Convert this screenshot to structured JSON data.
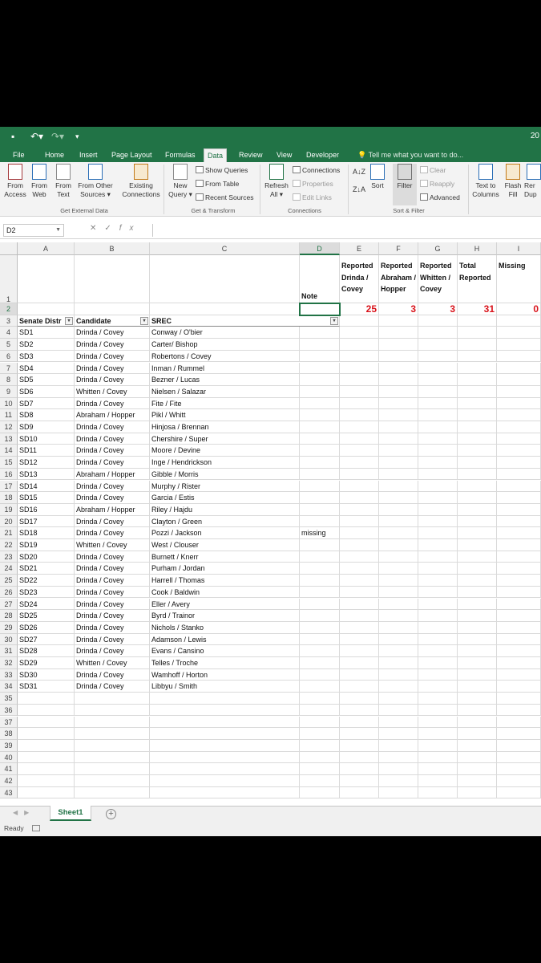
{
  "app": {
    "title_fragment": "20",
    "quick_access": [
      "save-icon",
      "undo-icon",
      "redo-icon",
      "customize-icon"
    ]
  },
  "tabs": [
    "File",
    "Home",
    "Insert",
    "Page Layout",
    "Formulas",
    "Data",
    "Review",
    "View",
    "Developer"
  ],
  "active_tab": "Data",
  "tell_me": "Tell me what you want to do...",
  "ribbon": {
    "get_external": {
      "label": "Get External Data",
      "buttons": [
        {
          "line1": "From",
          "line2": "Access"
        },
        {
          "line1": "From",
          "line2": "Web"
        },
        {
          "line1": "From",
          "line2": "Text"
        },
        {
          "line1": "From Other",
          "line2": "Sources ▾"
        },
        {
          "line1": "Existing",
          "line2": "Connections"
        }
      ]
    },
    "get_transform": {
      "label": "Get & Transform",
      "new_query": {
        "line1": "New",
        "line2": "Query ▾"
      },
      "small": [
        "Show Queries",
        "From Table",
        "Recent Sources"
      ]
    },
    "connections": {
      "label": "Connections",
      "refresh": {
        "line1": "Refresh",
        "line2": "All ▾"
      },
      "small": [
        "Connections",
        "Properties",
        "Edit Links"
      ]
    },
    "sort_filter": {
      "label": "Sort & Filter",
      "sort": "Sort",
      "filter": "Filter",
      "small": [
        "Clear",
        "Reapply",
        "Advanced"
      ]
    },
    "tools": [
      {
        "line1": "Text to",
        "line2": "Columns"
      },
      {
        "line1": "Flash",
        "line2": "Fill"
      },
      {
        "line1": "Rer",
        "line2": "Dup"
      }
    ]
  },
  "formula_bar": {
    "name_box": "D2",
    "formula": ""
  },
  "columns": [
    "A",
    "B",
    "C",
    "D",
    "E",
    "F",
    "G",
    "H",
    "I"
  ],
  "selected_column": "D",
  "selected_row": "2",
  "header_row1": {
    "D": "Note",
    "E": "Reported Drinda / Covey",
    "F": "Reported Abraham / Hopper",
    "G": "Reported Whitten / Covey",
    "H": "Total Reported",
    "I": "Missing"
  },
  "totals_row2": {
    "E": "25",
    "F": "3",
    "G": "3",
    "H": "31",
    "I": "0"
  },
  "table_headers": [
    "Senate Distr",
    "Candidate",
    "SREC"
  ],
  "rows": [
    {
      "district": "SD1",
      "candidate": "Drinda / Covey",
      "srec": "Conway / O'bier",
      "note": ""
    },
    {
      "district": "SD2",
      "candidate": "Drinda / Covey",
      "srec": "Carter/ Bishop",
      "note": ""
    },
    {
      "district": "SD3",
      "candidate": "Drinda / Covey",
      "srec": "Robertons / Covey",
      "note": ""
    },
    {
      "district": "SD4",
      "candidate": "Drinda / Covey",
      "srec": "Inman / Rummel",
      "note": ""
    },
    {
      "district": "SD5",
      "candidate": "Drinda / Covey",
      "srec": "Bezner / Lucas",
      "note": ""
    },
    {
      "district": "SD6",
      "candidate": "Whitten / Covey",
      "srec": "Nielsen / Salazar",
      "note": ""
    },
    {
      "district": "SD7",
      "candidate": "Drinda / Covey",
      "srec": "Fite / Fite",
      "note": ""
    },
    {
      "district": "SD8",
      "candidate": "Abraham / Hopper",
      "srec": "Pikl / Whitt",
      "note": ""
    },
    {
      "district": "SD9",
      "candidate": "Drinda / Covey",
      "srec": "Hinjosa / Brennan",
      "note": ""
    },
    {
      "district": "SD10",
      "candidate": "Drinda / Covey",
      "srec": "Chershire / Super",
      "note": ""
    },
    {
      "district": "SD11",
      "candidate": "Drinda / Covey",
      "srec": "Moore / Devine",
      "note": ""
    },
    {
      "district": "SD12",
      "candidate": "Drinda / Covey",
      "srec": "Inge / Hendrickson",
      "note": ""
    },
    {
      "district": "SD13",
      "candidate": "Abraham / Hopper",
      "srec": "Gibble / Morris",
      "note": ""
    },
    {
      "district": "SD14",
      "candidate": "Drinda / Covey",
      "srec": "Murphy / Rister",
      "note": ""
    },
    {
      "district": "SD15",
      "candidate": "Drinda / Covey",
      "srec": "Garcia / Estis",
      "note": ""
    },
    {
      "district": "SD16",
      "candidate": "Abraham / Hopper",
      "srec": "Riley / Hajdu",
      "note": ""
    },
    {
      "district": "SD17",
      "candidate": "Drinda / Covey",
      "srec": "Clayton / Green",
      "note": ""
    },
    {
      "district": "SD18",
      "candidate": "Drinda / Covey",
      "srec": "Pozzi / Jackson",
      "note": "missing"
    },
    {
      "district": "SD19",
      "candidate": "Whitten / Covey",
      "srec": "West / Clouser",
      "note": ""
    },
    {
      "district": "SD20",
      "candidate": "Drinda / Covey",
      "srec": "Burnett / Knerr",
      "note": ""
    },
    {
      "district": "SD21",
      "candidate": "Drinda / Covey",
      "srec": "Purham / Jordan",
      "note": ""
    },
    {
      "district": "SD22",
      "candidate": "Drinda / Covey",
      "srec": "Harrell / Thomas",
      "note": ""
    },
    {
      "district": "SD23",
      "candidate": "Drinda / Covey",
      "srec": "Cook / Baldwin",
      "note": ""
    },
    {
      "district": "SD24",
      "candidate": "Drinda / Covey",
      "srec": "Eller / Avery",
      "note": ""
    },
    {
      "district": "SD25",
      "candidate": "Drinda / Covey",
      "srec": "Byrd / Trainor",
      "note": ""
    },
    {
      "district": "SD26",
      "candidate": "Drinda / Covey",
      "srec": "Nichols / Stanko",
      "note": ""
    },
    {
      "district": "SD27",
      "candidate": "Drinda / Covey",
      "srec": "Adamson / Lewis",
      "note": ""
    },
    {
      "district": "SD28",
      "candidate": "Drinda / Covey",
      "srec": "Evans / Cansino",
      "note": ""
    },
    {
      "district": "SD29",
      "candidate": "Whitten / Covey",
      "srec": "Telles / Troche",
      "note": ""
    },
    {
      "district": "SD30",
      "candidate": "Drinda / Covey",
      "srec": "Wamhoff / Horton",
      "note": ""
    },
    {
      "district": "SD31",
      "candidate": "Drinda / Covey",
      "srec": "Libbyu / Smith",
      "note": ""
    }
  ],
  "empty_rows": [
    "35",
    "36",
    "37",
    "38",
    "39",
    "40",
    "41",
    "42",
    "43"
  ],
  "sheet_tab": "Sheet1",
  "add_sheet": "+",
  "status": "Ready",
  "colors": {
    "accent": "#217346",
    "totals": "#d9131b"
  }
}
